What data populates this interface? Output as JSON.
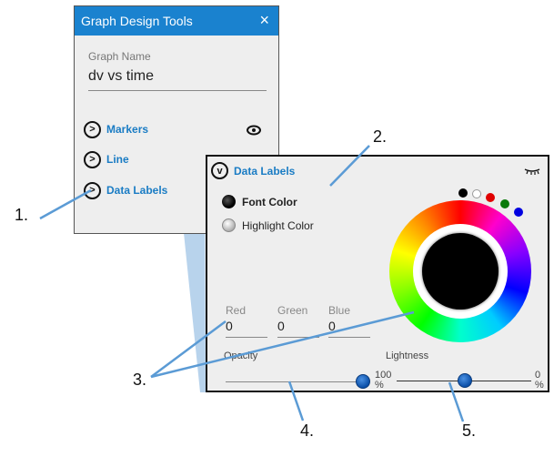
{
  "panel1": {
    "title": "Graph Design Tools",
    "close_icon": "×",
    "graph_name_label": "Graph Name",
    "graph_name_value": "dv vs time",
    "items": [
      {
        "label": "Markers",
        "icon": "chevron-right-icon",
        "visibility": "eye-open-icon"
      },
      {
        "label": "Line",
        "icon": "chevron-right-icon"
      },
      {
        "label": "Data Labels",
        "icon": "chevron-right-icon"
      }
    ]
  },
  "panel2": {
    "title": "Data Labels",
    "expand_icon": "chevron-down-icon",
    "visibility_icon": "eye-closed-icon",
    "color_targets": [
      {
        "label": "Font Color",
        "selected": true
      },
      {
        "label": "Highlight Color",
        "selected": false
      }
    ],
    "preset_swatches": [
      "#000000",
      "#ffffff",
      "#e00000",
      "#0a7a0a",
      "#0000e0"
    ],
    "current_color": "#000000",
    "rgb": {
      "red_label": "Red",
      "red_value": "0",
      "green_label": "Green",
      "green_value": "0",
      "blue_label": "Blue",
      "blue_value": "0"
    },
    "opacity": {
      "label": "Opacity",
      "value_percent": 100
    },
    "lightness": {
      "label": "Lightness",
      "left_label": "100\n%",
      "right_label": "0\n%",
      "value_percent": 50
    }
  },
  "callouts": [
    "1.",
    "2.",
    "3.",
    "4.",
    "5."
  ],
  "colors": {
    "header_blue": "#1a82cf",
    "link_blue": "#1a7cc4",
    "callout_line": "#5b9bd5"
  }
}
